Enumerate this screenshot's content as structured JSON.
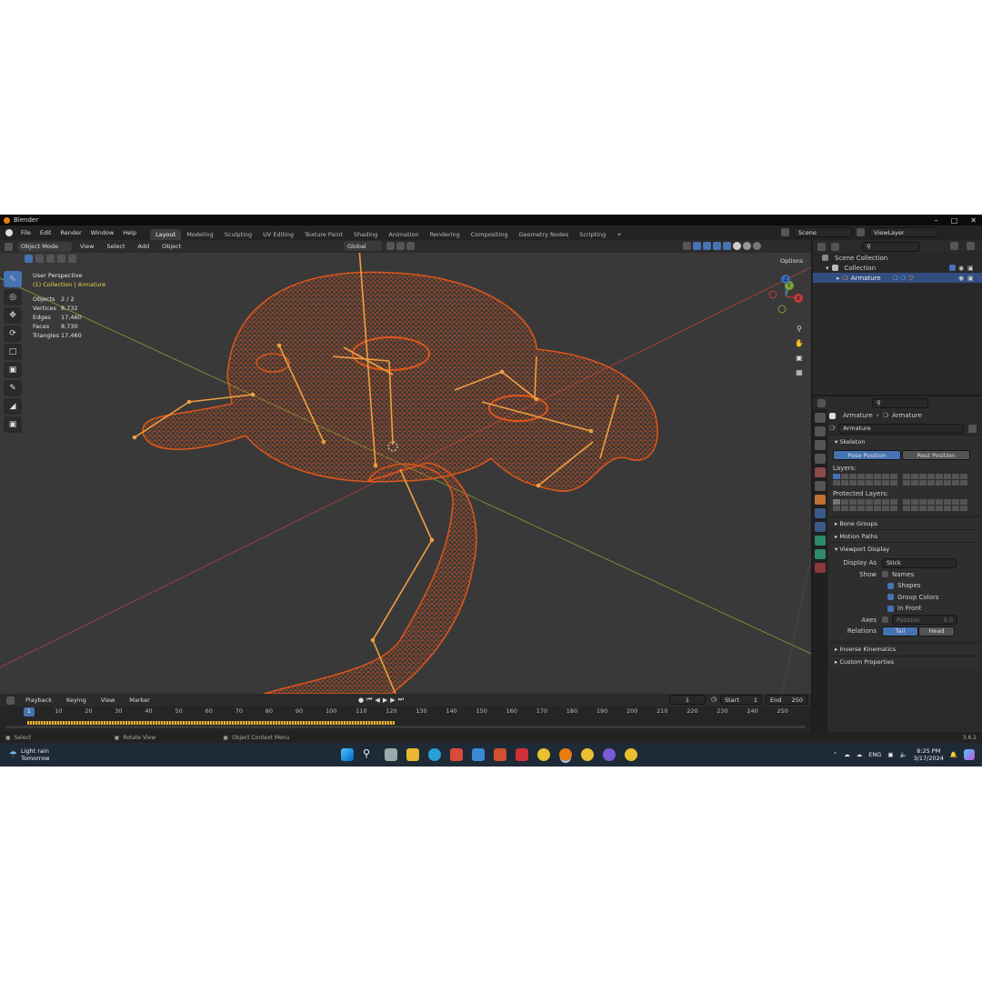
{
  "window": {
    "title": "Blender"
  },
  "menu": [
    "File",
    "Edit",
    "Render",
    "Window",
    "Help"
  ],
  "workspaces": [
    "Layout",
    "Modeling",
    "Sculpting",
    "UV Editing",
    "Texture Paint",
    "Shading",
    "Animation",
    "Rendering",
    "Compositing",
    "Geometry Nodes",
    "Scripting"
  ],
  "active_workspace": "Layout",
  "scene": {
    "name": "Scene",
    "view_layer": "ViewLayer"
  },
  "viewport": {
    "mode": "Object Mode",
    "menus": [
      "View",
      "Select",
      "Add",
      "Object"
    ],
    "transform": "Global",
    "options": "Options",
    "perspective": "User Perspective",
    "context": "(1) Collection | Armature",
    "stats": [
      {
        "label": "Objects",
        "value": "2 / 2"
      },
      {
        "label": "Vertices",
        "value": "8,732"
      },
      {
        "label": "Edges",
        "value": "17,460"
      },
      {
        "label": "Faces",
        "value": "8,730"
      },
      {
        "label": "Triangles",
        "value": "17,460"
      }
    ],
    "gizmo": {
      "x": "X",
      "y": "Y",
      "z": "Z"
    }
  },
  "timeline": {
    "menus": [
      "Playback",
      "Keying",
      "View",
      "Marker"
    ],
    "current_frame": "1",
    "start_label": "Start",
    "start": "1",
    "end_label": "End",
    "end": "250",
    "ticks": [
      "10",
      "20",
      "30",
      "40",
      "50",
      "60",
      "70",
      "80",
      "90",
      "100",
      "110",
      "120",
      "130",
      "140",
      "150",
      "160",
      "170",
      "180",
      "190",
      "200",
      "210",
      "220",
      "230",
      "240",
      "250"
    ]
  },
  "statusbar": {
    "select": "Select",
    "rotate": "Rotate View",
    "context": "Object Context Menu",
    "version": "3.6.2"
  },
  "outliner": {
    "root": "Scene Collection",
    "collection": "Collection",
    "item": "Armature"
  },
  "properties": {
    "breadcrumb_a": "Armature",
    "breadcrumb_b": "Armature",
    "name_field": "Armature",
    "skeleton": {
      "title": "Skeleton",
      "pose_position": "Pose Position",
      "rest_position": "Rest Position",
      "layers": "Layers:",
      "protected_layers": "Protected Layers:"
    },
    "bone_groups": "Bone Groups",
    "motion_paths": "Motion Paths",
    "viewport_display": {
      "title": "Viewport Display",
      "display_as_label": "Display As",
      "display_as": "Stick",
      "show_label": "Show",
      "names": "Names",
      "shapes": "Shapes",
      "group_colors": "Group Colors",
      "in_front": "In Front",
      "axes_label": "Axes",
      "position_label": "Position",
      "position_value": "0.0",
      "relations_label": "Relations",
      "tail": "Tail",
      "head": "Head"
    },
    "inverse_kinematics": "Inverse Kinematics",
    "custom_properties": "Custom Properties"
  },
  "taskbar": {
    "weather": "Light rain",
    "weather_sub": "Tomorrow",
    "lang": "ENG",
    "time": "8:25 PM",
    "date": "3/17/2024"
  },
  "colors": {
    "accent": "#4772b3",
    "wire": "#e0561b",
    "bone": "#f0a040",
    "axis_x": "#c23a3a",
    "axis_y": "#7fa33a"
  }
}
